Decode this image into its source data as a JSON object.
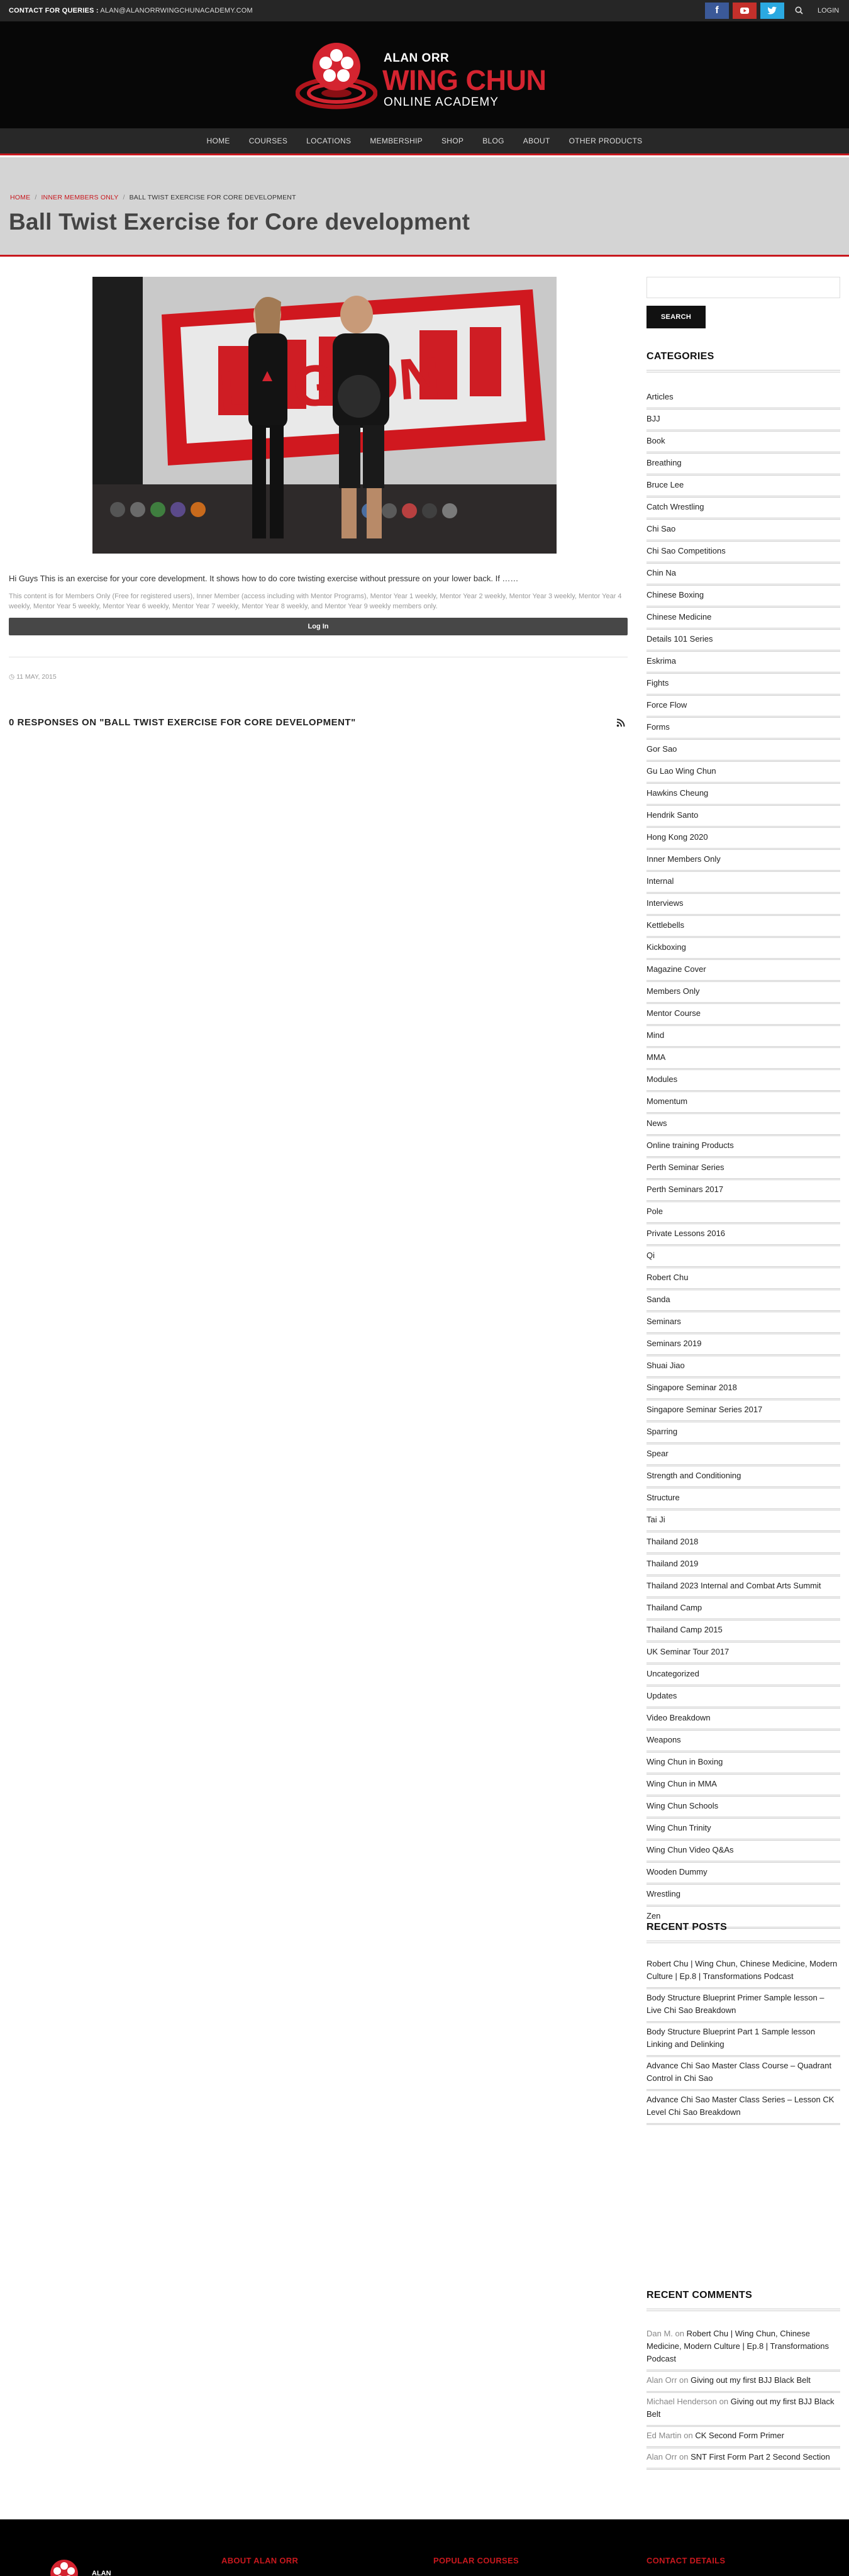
{
  "topbar": {
    "contact_label": "CONTACT FOR QUERIES :",
    "contact_email": "ALAN@ALANORRWINGCHUNACADEMY.COM",
    "login": "LOGIN"
  },
  "logo": {
    "line1": "ALAN ORR",
    "line2": "WING CHUN",
    "line3": "ONLINE ACADEMY"
  },
  "nav": [
    "HOME",
    "COURSES",
    "LOCATIONS",
    "MEMBERSHIP",
    "SHOP",
    "BLOG",
    "ABOUT",
    "OTHER PRODUCTS"
  ],
  "breadcrumb": {
    "home": "HOME",
    "parent": "INNER MEMBERS ONLY",
    "current": "BALL TWIST EXERCISE FOR CORE DEVELOPMENT"
  },
  "page_title": "Ball Twist Exercise for Core development",
  "video": {
    "wall_text": "LEGION"
  },
  "post": {
    "excerpt": "Hi Guys This is an exercise for your core development. It shows how to do core twisting exercise without pressure on your lower back. If ……",
    "notice": "This content is for Members Only (Free for registered users), Inner Member (access including with Mentor Programs), Mentor Year 1 weekly, Mentor Year 2 weekly, Mentor Year 3 weekly, Mentor Year 4 weekly, Mentor Year 5 weekly, Mentor Year 6 weekly, Mentor Year 7 weekly, Mentor Year 8 weekly, and Mentor Year 9 weekly members only.",
    "login_button": "Log In",
    "date": "11 MAY, 2015",
    "responses": "0 RESPONSES ON \"BALL TWIST EXERCISE FOR CORE DEVELOPMENT\""
  },
  "sidebar": {
    "search_button": "SEARCH",
    "categories_title": "CATEGORIES",
    "categories": [
      "Articles",
      "BJJ",
      "Book",
      "Breathing",
      "Bruce Lee",
      "Catch Wrestling",
      "Chi Sao",
      "Chi Sao Competitions",
      "Chin Na",
      "Chinese Boxing",
      "Chinese Medicine",
      "Details 101 Series",
      "Eskrima",
      "Fights",
      "Force Flow",
      "Forms",
      "Gor Sao",
      "Gu Lao Wing Chun",
      "Hawkins Cheung",
      "Hendrik Santo",
      "Hong Kong 2020",
      "Inner Members Only",
      "Internal",
      "Interviews",
      "Kettlebells",
      "Kickboxing",
      "Magazine Cover",
      "Members Only",
      "Mentor Course",
      "Mind",
      "MMA",
      "Modules",
      "Momentum",
      "News",
      "Online training Products",
      "Perth Seminar Series",
      "Perth Seminars 2017",
      "Pole",
      "Private Lessons 2016",
      "Qi",
      "Robert Chu",
      "Sanda",
      "Seminars",
      "Seminars 2019",
      "Shuai Jiao",
      "Singapore Seminar 2018",
      "Singapore Seminar Series 2017",
      "Sparring",
      "Spear",
      "Strength and Conditioning",
      "Structure",
      "Tai Ji",
      "Thailand 2018",
      "Thailand 2019",
      "Thailand 2023 Internal and Combat Arts Summit",
      "Thailand Camp",
      "Thailand Camp 2015",
      "UK Seminar Tour 2017",
      "Uncategorized",
      "Updates",
      "Video Breakdown",
      "Weapons",
      "Wing Chun in Boxing",
      "Wing Chun in MMA",
      "Wing Chun Schools",
      "Wing Chun Trinity",
      "Wing Chun Video Q&As",
      "Wooden Dummy",
      "Wrestling",
      "Zen"
    ],
    "recent_posts_title": "RECENT POSTS",
    "recent_posts": [
      "Robert Chu | Wing Chun, Chinese Medicine, Modern Culture | Ep.8 | Transformations Podcast",
      "Body Structure Blueprint Primer Sample lesson – Live Chi Sao Breakdown",
      "Body Structure Blueprint Part 1 Sample lesson Linking and Delinking",
      "Advance Chi Sao Master Class Course – Quadrant Control in Chi Sao",
      "Advance Chi Sao Master Class Series – Lesson CK Level Chi Sao Breakdown"
    ],
    "recent_comments_title": "RECENT COMMENTS",
    "recent_comments": [
      {
        "author": "Dan M.",
        "on": "on",
        "post": "Robert Chu | Wing Chun, Chinese Medicine, Modern Culture | Ep.8 | Transformations Podcast"
      },
      {
        "author": "Alan Orr",
        "on": "on",
        "post": "Giving out my first BJJ Black Belt"
      },
      {
        "author": "Michael Henderson",
        "on": "on",
        "post": "Giving out my first BJJ Black Belt"
      },
      {
        "author": "Ed Martin",
        "on": "on",
        "post": "CK Second Form Primer"
      },
      {
        "author": "Alan Orr",
        "on": "on",
        "post": "SNT First Form Part 2 Second Section"
      }
    ]
  },
  "footer": {
    "logo_text": "ALAN ORR",
    "about": "ABOUT ALAN ORR",
    "popular": "POPULAR COURSES",
    "contact": "CONTACT DETAILS"
  },
  "colors": {
    "accent": "#c8181e",
    "topbar": "#262626",
    "nav": "#282828"
  }
}
